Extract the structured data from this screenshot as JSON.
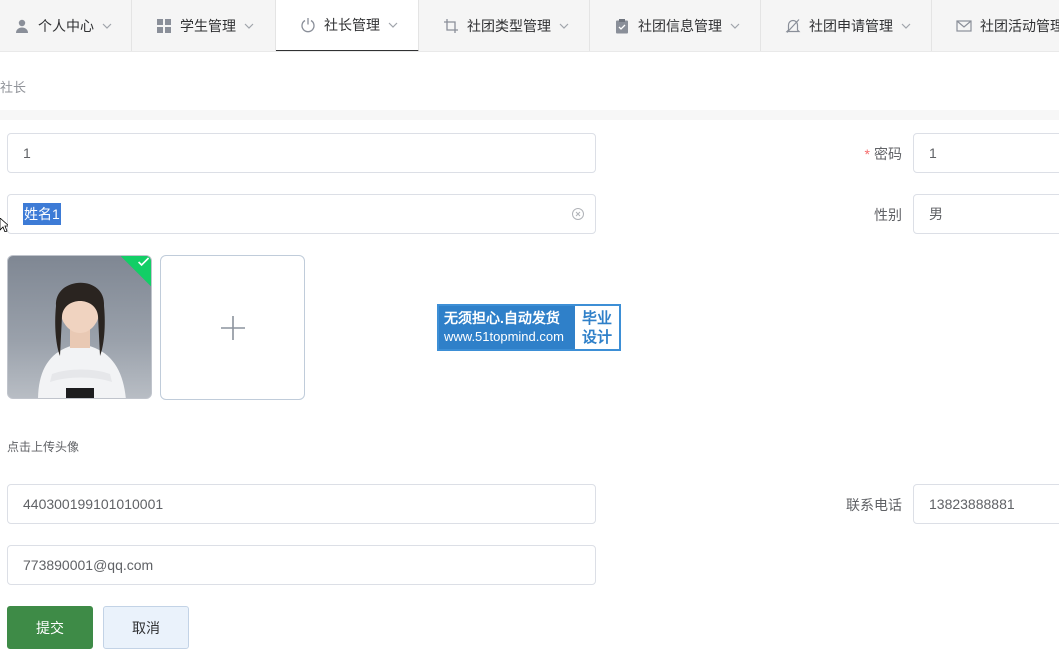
{
  "nav": {
    "items": [
      {
        "label": "个人中心",
        "icon": "user-icon"
      },
      {
        "label": "学生管理",
        "icon": "grid-icon"
      },
      {
        "label": "社长管理",
        "icon": "power-icon"
      },
      {
        "label": "社团类型管理",
        "icon": "crop-icon"
      },
      {
        "label": "社团信息管理",
        "icon": "clipboard-icon"
      },
      {
        "label": "社团申请管理",
        "icon": "bell-off-icon"
      },
      {
        "label": "社团活动管理",
        "icon": "mail-icon"
      }
    ],
    "active_index": 2
  },
  "breadcrumb": "社长",
  "form": {
    "account_value": "1",
    "password_label": "密码",
    "password_required": "*",
    "password_value": "1",
    "name_value": "姓名1",
    "gender_label": "性别",
    "gender_value": "男",
    "upload_tip": "点击上传头像",
    "id_value": "440300199101010001",
    "phone_label": "联系电话",
    "phone_value": "13823888881",
    "email_value": "773890001@qq.com"
  },
  "watermark": {
    "line1": "无须担心.自动发货",
    "line2": "www.51topmind.com",
    "right1": "毕业",
    "right2": "设计"
  },
  "buttons": {
    "submit": "提交",
    "cancel": "取消"
  },
  "colors": {
    "primary_button": "#3e8b47",
    "success_check": "#13ce66",
    "selection": "#3d7bd6",
    "required": "#f56c6c"
  }
}
